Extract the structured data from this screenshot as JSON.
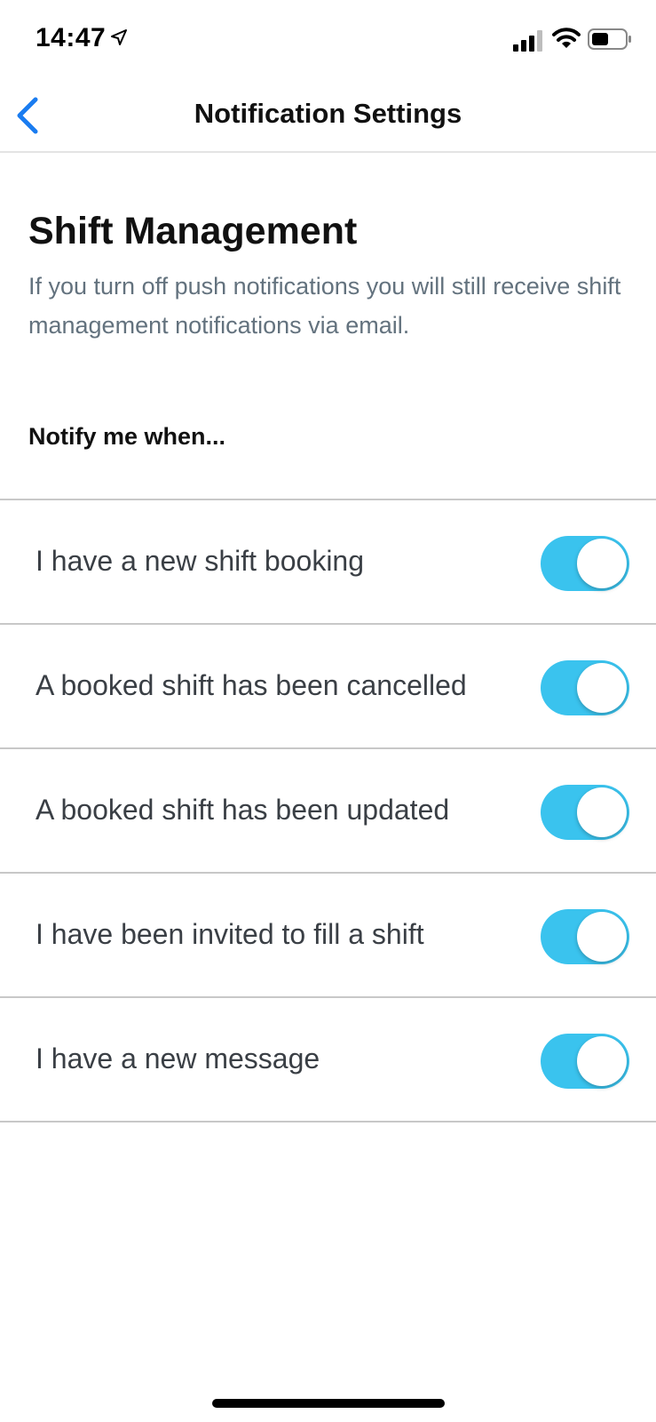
{
  "status_bar": {
    "time": "14:47",
    "icons": [
      "location-arrow-icon",
      "signal-icon",
      "wifi-icon",
      "battery-icon"
    ]
  },
  "nav": {
    "title": "Notification Settings",
    "back_icon": "chevron-left-icon"
  },
  "section": {
    "title": "Shift Management",
    "description": "If you turn off push notifications you will still receive shift management notifications via email.",
    "notify_label": "Notify me when..."
  },
  "settings": [
    {
      "label": "I have a new shift booking",
      "enabled": true
    },
    {
      "label": "A booked shift has been cancelled",
      "enabled": true
    },
    {
      "label": "A booked shift has been updated",
      "enabled": true
    },
    {
      "label": "I have been invited to fill a shift",
      "enabled": true
    },
    {
      "label": "I have a new message",
      "enabled": true
    }
  ],
  "colors": {
    "toggle_on": "#3ac3ee",
    "back_accent": "#1a7cf0",
    "description_text": "#63727e"
  }
}
